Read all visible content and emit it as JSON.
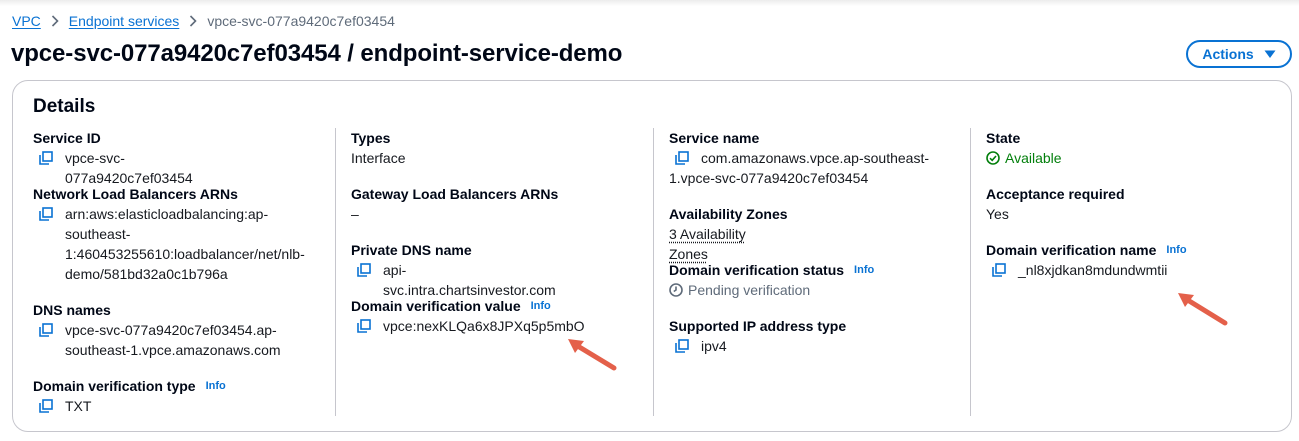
{
  "breadcrumb": {
    "root": "VPC",
    "section": "Endpoint services",
    "current": "vpce-svc-077a9420c7ef03454"
  },
  "page": {
    "title": "vpce-svc-077a9420c7ef03454 / endpoint-service-demo",
    "actions_label": "Actions"
  },
  "details": {
    "title": "Details",
    "info_label": "Info",
    "service_id": {
      "label": "Service ID",
      "value": "vpce-svc-077a9420c7ef03454"
    },
    "nlb_arns": {
      "label": "Network Load Balancers ARNs",
      "lines": [
        "arn:aws:elasticloadbalancing:ap-",
        "southeast-",
        "1:460453255610:loadbalancer/net/nlb-",
        "demo/581bd32a0c1b796a"
      ]
    },
    "dns_names": {
      "label": "DNS names",
      "lines": [
        "vpce-svc-077a9420c7ef03454.ap-",
        "southeast-1.vpce.amazonaws.com"
      ]
    },
    "domain_verification_type": {
      "label": "Domain verification type",
      "value": "TXT"
    },
    "types": {
      "label": "Types",
      "value": "Interface"
    },
    "gwlb_arns": {
      "label": "Gateway Load Balancers ARNs",
      "value": "–"
    },
    "private_dns": {
      "label": "Private DNS name",
      "value": "api-svc.intra.chartsinvestor.com"
    },
    "domain_verification_value": {
      "label": "Domain verification value",
      "value": "vpce:nexKLQa6x8JPXq5p5mbO"
    },
    "service_name": {
      "label": "Service name",
      "lines": [
        "com.amazonaws.vpce.ap-southeast-",
        "1.vpce-svc-077a9420c7ef03454"
      ]
    },
    "availability_zones": {
      "label": "Availability Zones",
      "value": "3 Availability Zones"
    },
    "domain_verification_status": {
      "label": "Domain verification status",
      "value": "Pending verification"
    },
    "supported_ip": {
      "label": "Supported IP address type",
      "value": "ipv4"
    },
    "state": {
      "label": "State",
      "value": "Available"
    },
    "acceptance": {
      "label": "Acceptance required",
      "value": "Yes"
    },
    "domain_verification_name": {
      "label": "Domain verification name",
      "value": "_nl8xjdkan8mdundwmtii"
    }
  },
  "colors": {
    "link": "#0972d3",
    "success": "#037f0c",
    "muted": "#5f6b7a",
    "annotation_arrow": "#e4604a"
  }
}
